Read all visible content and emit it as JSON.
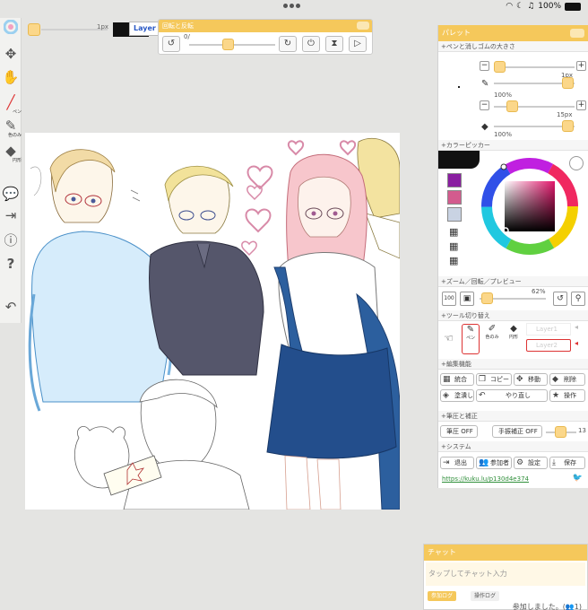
{
  "status": {
    "battery_pct": "100%"
  },
  "top_strip": {
    "size_label": "1px",
    "layer_button": "Layer 2"
  },
  "rotate_panel": {
    "title": "回転と反転",
    "zero_label": "0/",
    "slider_value": 0.45
  },
  "left_toolbar": {
    "pen_label": "ペン",
    "picker_label": "色のみ",
    "fill_label": "円形"
  },
  "palette": {
    "title": "パレット",
    "sections": {
      "size": "+ペンと消しゴムの大きさ",
      "color": "+カラーピッカー",
      "zoom": "+ズーム／回転／プレビュー",
      "tool": "+ツール切り替え",
      "edit": "+編集機能",
      "correct": "+筆圧と補正",
      "system": "+システム"
    },
    "pen_size": "1px",
    "pen_opacity": "100%",
    "eraser_size": "15px",
    "eraser_opacity": "100%",
    "swatch_colors": [
      "#8a1fa1",
      "#d35b8e",
      "#c9d3e3"
    ],
    "zoom_100": "100",
    "zoom_pct": "62%",
    "tool_labels": {
      "pen": "ペン",
      "picker": "色のみ",
      "fill": "円形"
    },
    "layer_labels": [
      "Layer1",
      "Layer2"
    ],
    "edit_buttons": [
      "統合",
      "コピー",
      "移動",
      "削除",
      "塗潰し",
      "やり直し",
      "操作"
    ],
    "pressure_button": "筆圧 OFF",
    "correction_button": "手振補正 OFF",
    "correction_value": "13",
    "system_buttons": [
      "退出",
      "参加者",
      "設定",
      "保存"
    ],
    "room_link": "https://kuku.lu/p130d4e374"
  },
  "chat": {
    "title": "チャット",
    "placeholder": "タップしてチャット入力",
    "tab_log": "参加ログ",
    "tab_ops": "操作ログ",
    "message": "参加しました。(👥1)"
  }
}
